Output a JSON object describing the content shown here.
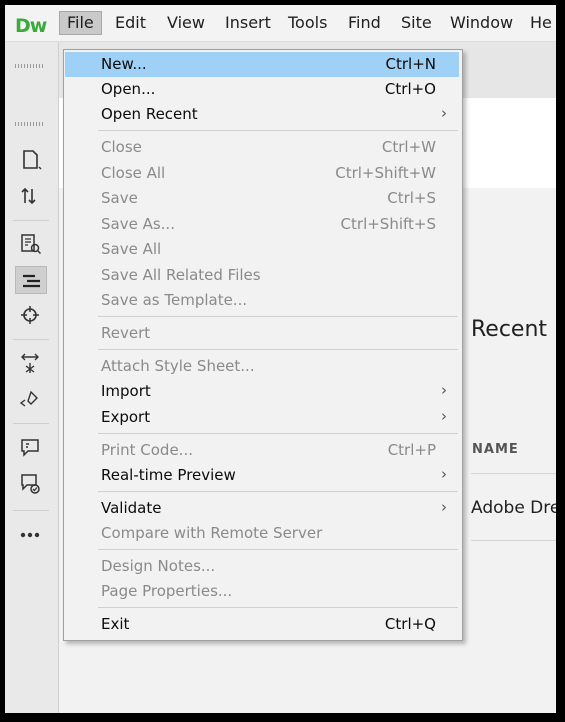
{
  "app": {
    "logo": "Dw"
  },
  "menubar": {
    "items": [
      "File",
      "Edit",
      "View",
      "Insert",
      "Tools",
      "Find",
      "Site",
      "Window",
      "He"
    ]
  },
  "toolbar": {
    "icons": [
      "new-document-icon",
      "file-transfer-icon",
      "inspect-icon",
      "dom-panel-icon",
      "target-icon",
      "expand-icon",
      "code-hints-icon",
      "comment-icon",
      "comment-check-icon",
      "more-icon"
    ]
  },
  "start": {
    "recent_title": "Recent",
    "name_header": "NAME",
    "recent_row": "Adobe Dre"
  },
  "file_menu": {
    "new": {
      "label": "New...",
      "shortcut": "Ctrl+N"
    },
    "open": {
      "label": "Open...",
      "shortcut": "Ctrl+O"
    },
    "open_recent": {
      "label": "Open Recent",
      "submenu": "›"
    },
    "close": {
      "label": "Close",
      "shortcut": "Ctrl+W"
    },
    "close_all": {
      "label": "Close All",
      "shortcut": "Ctrl+Shift+W"
    },
    "save": {
      "label": "Save",
      "shortcut": "Ctrl+S"
    },
    "save_as": {
      "label": "Save As...",
      "shortcut": "Ctrl+Shift+S"
    },
    "save_all": {
      "label": "Save All"
    },
    "save_all_related": {
      "label": "Save All Related Files"
    },
    "save_as_template": {
      "label": "Save as Template..."
    },
    "revert": {
      "label": "Revert"
    },
    "attach_style_sheet": {
      "label": "Attach Style Sheet..."
    },
    "import": {
      "label": "Import",
      "submenu": "›"
    },
    "export": {
      "label": "Export",
      "submenu": "›"
    },
    "print_code": {
      "label": "Print Code...",
      "shortcut": "Ctrl+P"
    },
    "realtime_preview": {
      "label": "Real-time Preview",
      "submenu": "›"
    },
    "validate": {
      "label": "Validate",
      "submenu": "›"
    },
    "compare_remote": {
      "label": "Compare with Remote Server"
    },
    "design_notes": {
      "label": "Design Notes..."
    },
    "page_properties": {
      "label": "Page Properties..."
    },
    "exit": {
      "label": "Exit",
      "shortcut": "Ctrl+Q"
    }
  },
  "colors": {
    "highlight": "#9fd0f5",
    "logo": "#3ba93b",
    "disabled_text": "#8a8a8a"
  }
}
